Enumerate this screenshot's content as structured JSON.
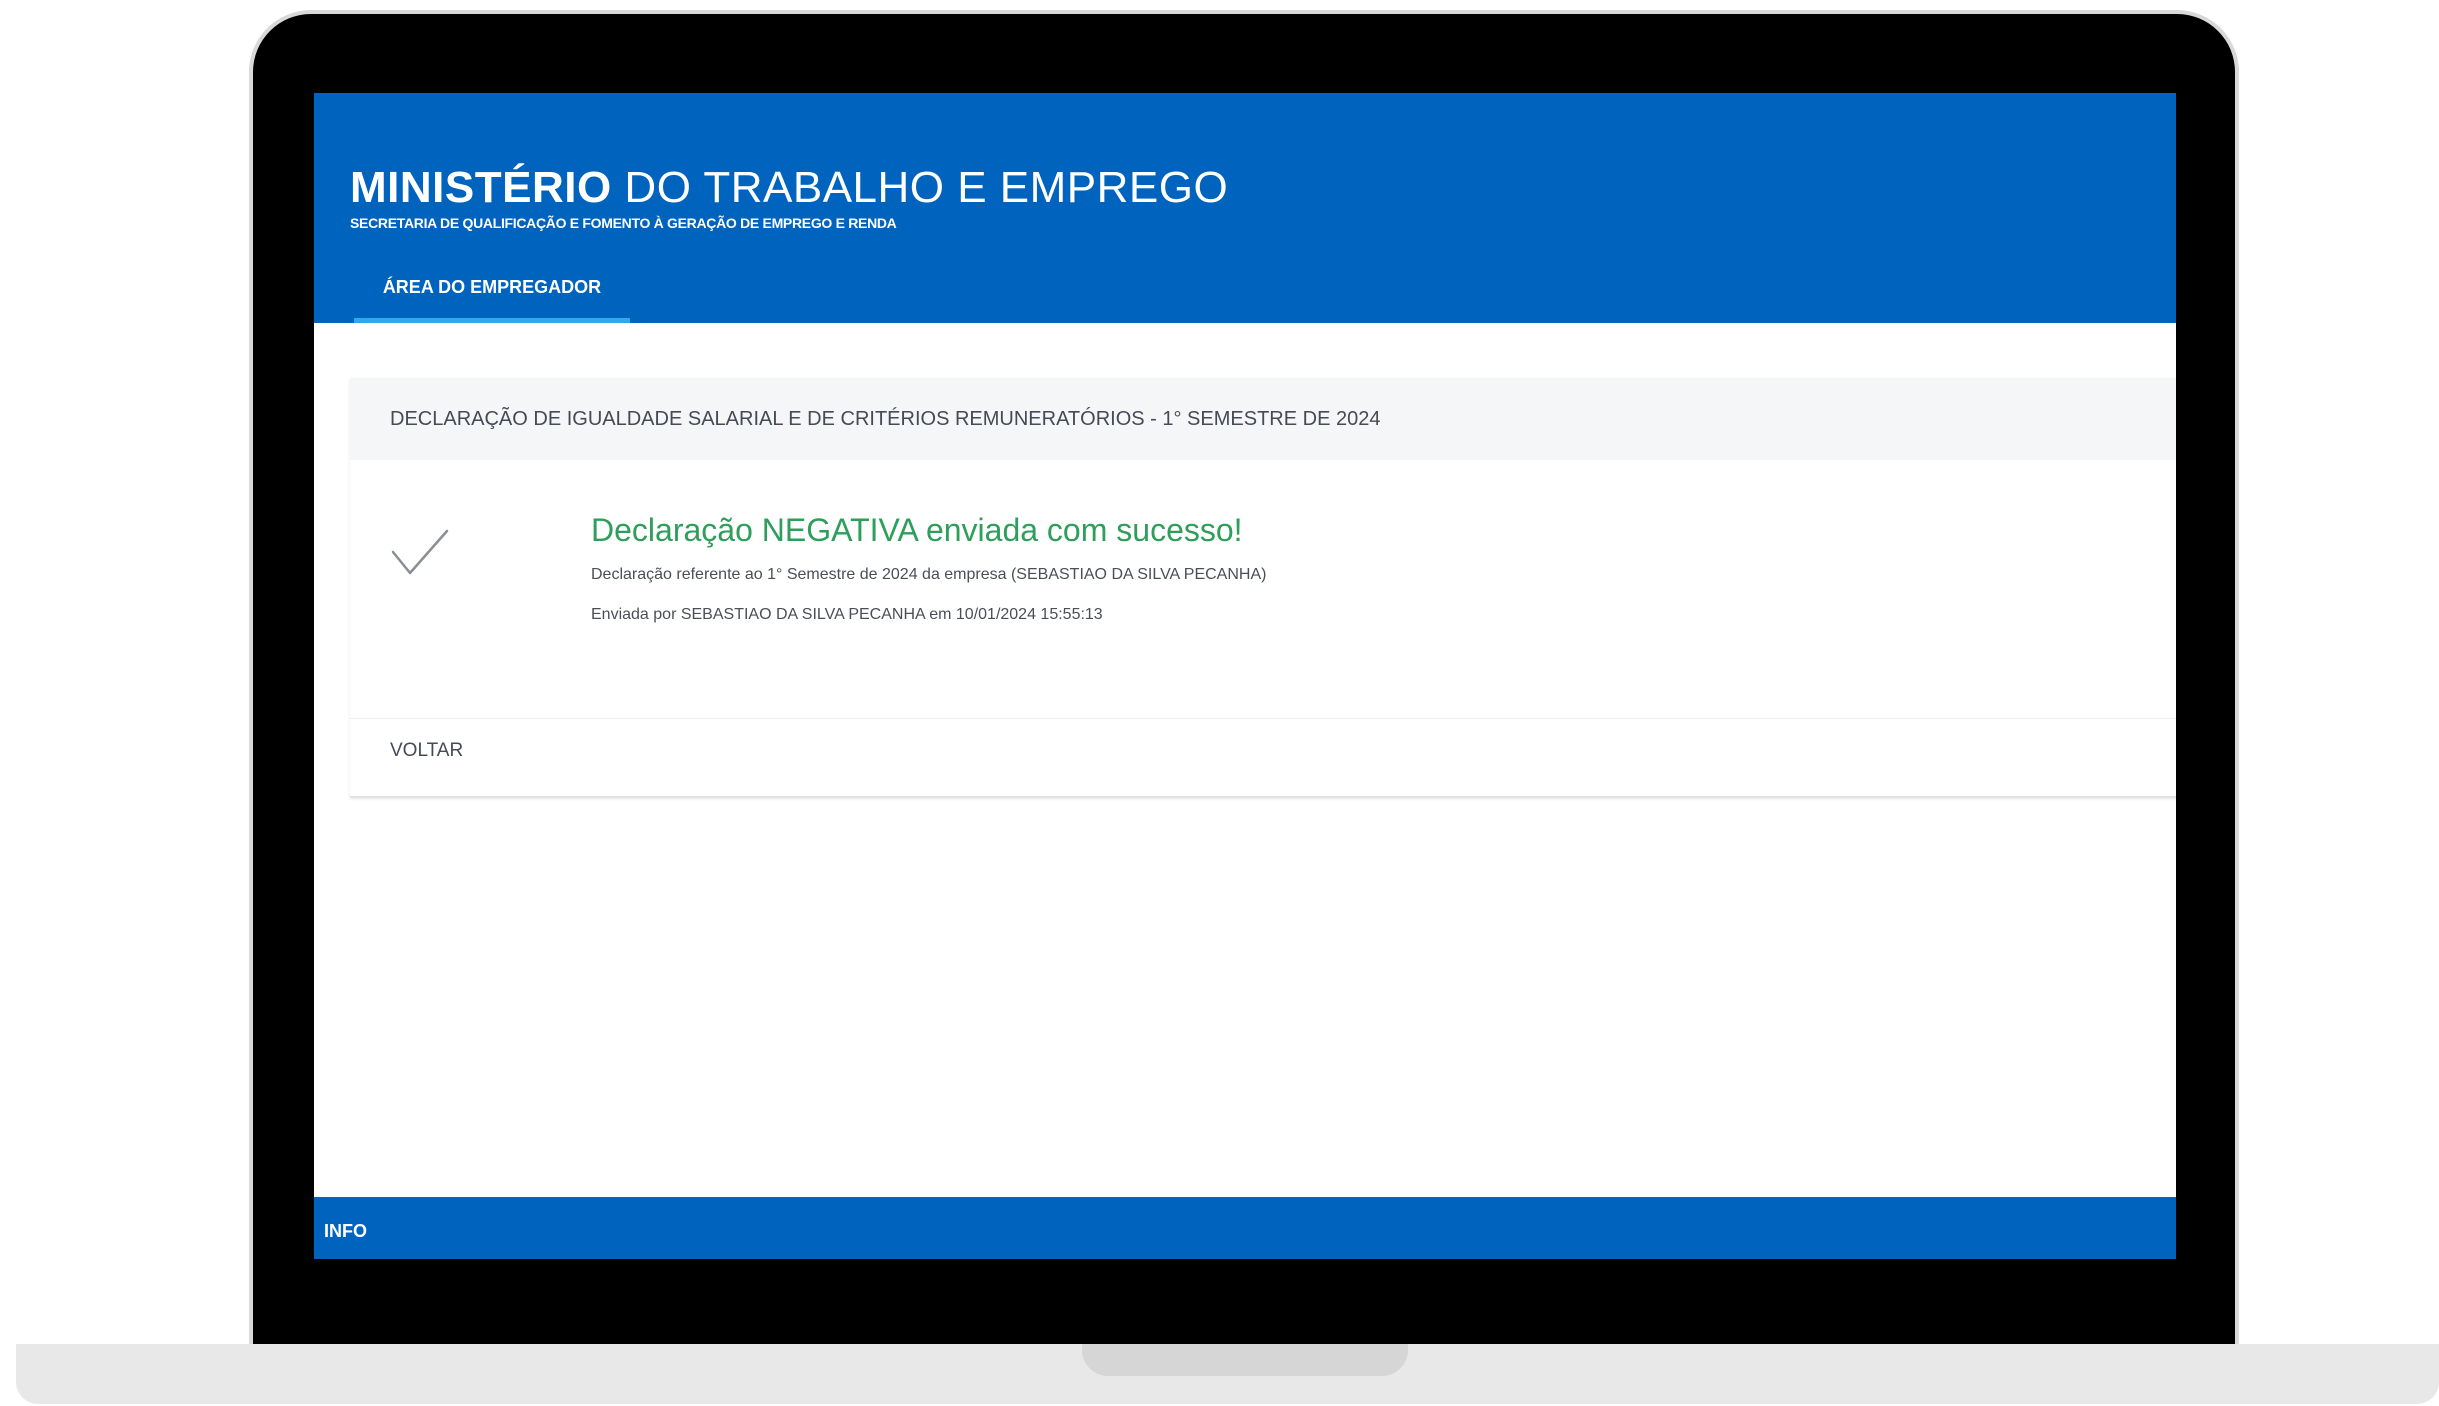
{
  "header": {
    "title_strong": "MINISTÉRIO",
    "title_light": " DO TRABALHO E EMPREGO",
    "subtitle": "SECRETARIA DE QUALIFICAÇÃO E FOMENTO À GERAÇÃO DE EMPREGO E RENDA",
    "tab_label": "ÁREA DO EMPREGADOR"
  },
  "card": {
    "header": "DECLARAÇÃO DE IGUALDADE SALARIAL E DE CRITÉRIOS REMUNERATÓRIOS - 1° SEMESTRE DE 2024",
    "success_title": "Declaração NEGATIVA enviada com sucesso!",
    "detail_1": "Declaração referente ao 1° Semestre de 2024 da empresa (SEBASTIAO DA SILVA PECANHA)",
    "detail_2": "Enviada por SEBASTIAO DA SILVA PECANHA em 10/01/2024 15:55:13",
    "back_label": "VOLTAR",
    "icon": "check-icon"
  },
  "footer": {
    "label": "INFO"
  },
  "colors": {
    "brand_blue": "#0063be",
    "tab_underline": "#2fa9e8",
    "success_green": "#2e9e5b",
    "check_gray": "#8a8f96"
  }
}
